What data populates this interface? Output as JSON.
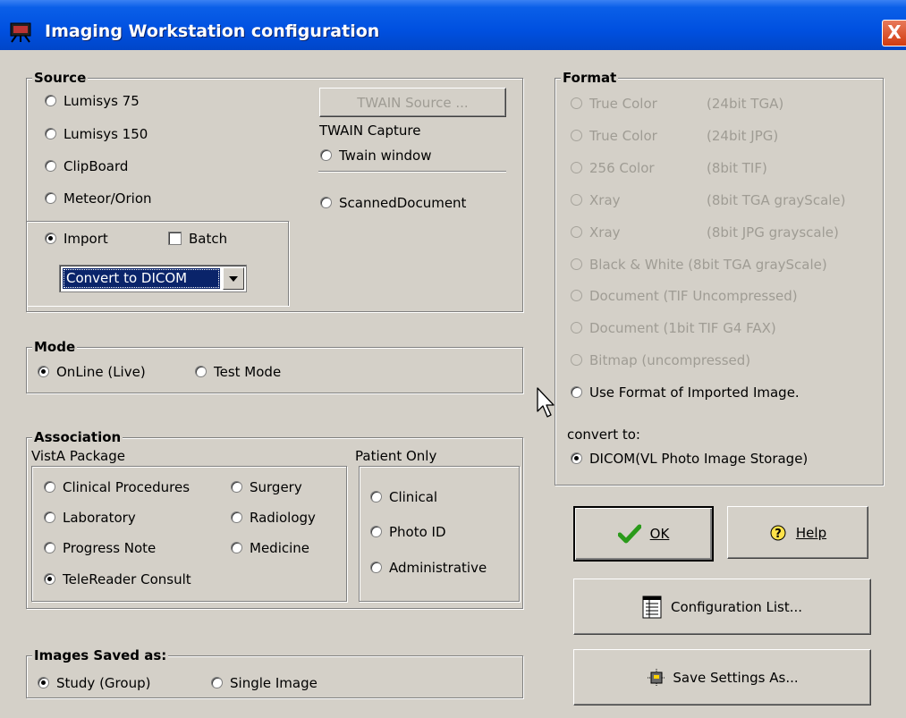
{
  "window": {
    "title": "Imaging Workstation configuration",
    "close": "X"
  },
  "source": {
    "legend": "Source",
    "options": [
      "Lumisys 75",
      "Lumisys 150",
      "ClipBoard",
      "Meteor/Orion"
    ],
    "import_label": "Import",
    "batch_label": "Batch",
    "import_action": "Convert to DICOM",
    "twain_source_button": "TWAIN Source ...",
    "twain_capture_label": "TWAIN Capture",
    "twain_window": "Twain window",
    "scanned_document": "ScannedDocument"
  },
  "mode": {
    "legend": "Mode",
    "online": "OnLine (Live)",
    "test": "Test Mode"
  },
  "association": {
    "legend": "Association",
    "vista_label": "VistA Package",
    "patient_label": "Patient Only",
    "vista_options": [
      "Clinical Procedures",
      "Surgery",
      "Laboratory",
      "Radiology",
      "Progress Note",
      "Medicine",
      "TeleReader Consult"
    ],
    "patient_options": [
      "Clinical",
      "Photo ID",
      "Administrative"
    ]
  },
  "images_saved": {
    "legend": "Images Saved as:",
    "study": "Study (Group)",
    "single": "Single Image"
  },
  "format": {
    "legend": "Format",
    "options": [
      {
        "name": "True Color",
        "detail": "(24bit TGA)"
      },
      {
        "name": "True Color",
        "detail": "(24bit JPG)"
      },
      {
        "name": "256 Color",
        "detail": "(8bit TIF)"
      },
      {
        "name": "Xray",
        "detail": "(8bit TGA grayScale)"
      },
      {
        "name": "Xray",
        "detail": "(8bit JPG grayscale)"
      },
      {
        "name": "Black & White (8bit TGA grayScale)",
        "detail": ""
      },
      {
        "name": "Document (TIF Uncompressed)",
        "detail": ""
      },
      {
        "name": "Document (1bit TIF G4 FAX)",
        "detail": ""
      },
      {
        "name": "Bitmap (uncompressed)",
        "detail": ""
      }
    ],
    "use_imported": "Use Format of Imported Image.",
    "convert_to_label": "convert to:",
    "dicom_option": "DICOM(VL Photo Image Storage)"
  },
  "buttons": {
    "ok": "OK",
    "help": "Help",
    "config_list": "Configuration List...",
    "save_settings": "Save Settings As..."
  },
  "icons": {
    "title": "camera-icon",
    "ok": "checkmark-icon",
    "help": "help-icon",
    "config_list": "list-icon",
    "save_settings": "save-settings-icon",
    "cursor": "mouse-pointer-icon"
  },
  "colors": {
    "title_bar": "#0050e0",
    "window_bg": "#d4d0c8",
    "close": "#d23b10",
    "selection": "#0a246a"
  }
}
